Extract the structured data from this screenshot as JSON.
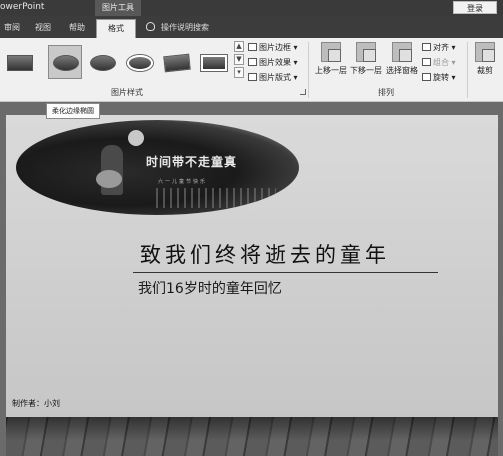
{
  "titlebar": {
    "app_title": "owerPoint",
    "context_tab": "图片工具",
    "login": "登录"
  },
  "tabs": [
    {
      "label": "审阅"
    },
    {
      "label": "视图"
    },
    {
      "label": "帮助"
    },
    {
      "label": "格式",
      "active": true
    }
  ],
  "tell_me": "操作说明搜索",
  "ribbon": {
    "picture_styles_group": "图片样式",
    "border": "图片边框",
    "effects": "图片效果",
    "layout": "图片版式",
    "arrange_group": "排列",
    "bring_forward": "上移一层",
    "send_backward": "下移一层",
    "selection_pane": "选择窗格",
    "align": "对齐",
    "group": "组合",
    "rotate": "旋转",
    "crop": "裁剪"
  },
  "tooltip": "柔化边缘椭圆",
  "slide": {
    "image_text": "时间带不走童真",
    "image_subtext": "六一儿童节快乐",
    "title": "致我们终将逝去的童年",
    "subtitle": "我们16岁时的童年回忆",
    "author": "制作者：小刘"
  }
}
